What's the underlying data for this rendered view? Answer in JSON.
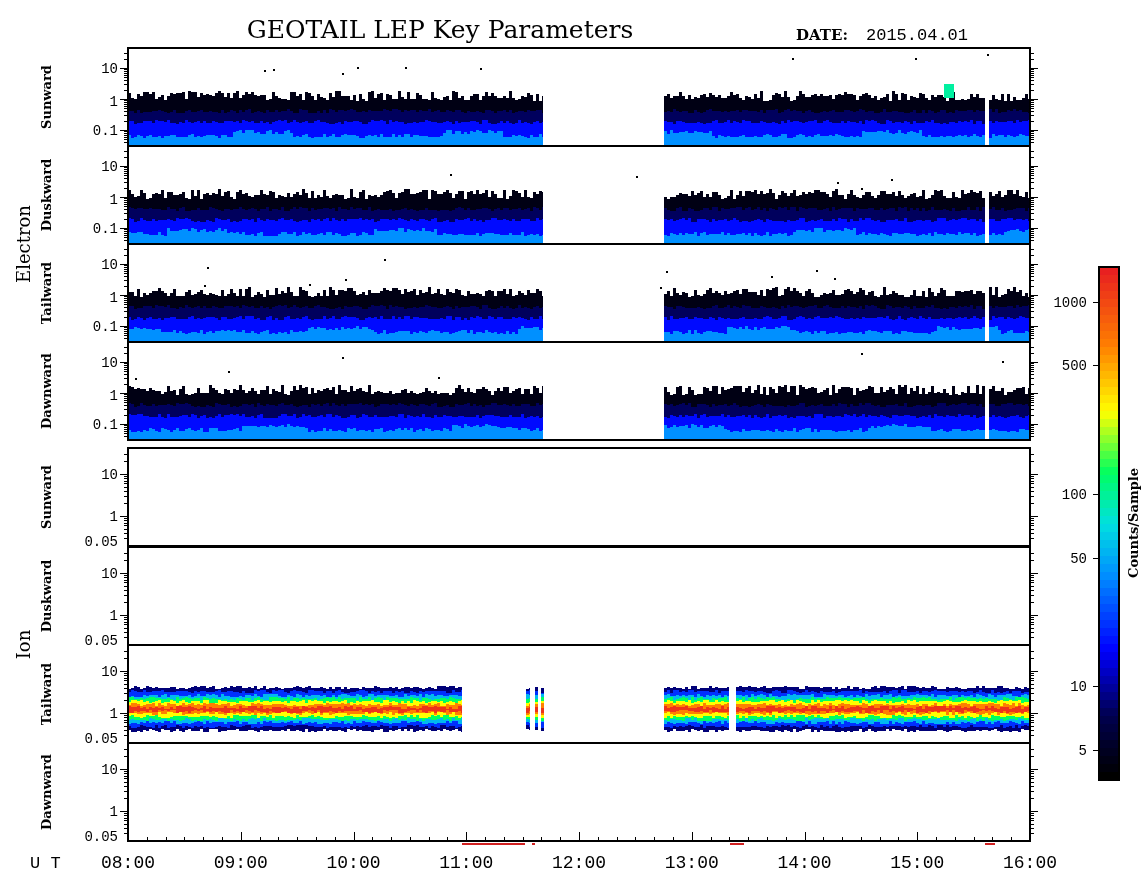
{
  "title": "GEOTAIL LEP Key Parameters",
  "date": {
    "label": "DATE:",
    "value": "2015.04.01"
  },
  "groups": [
    {
      "name": "Electron",
      "panels": [
        {
          "name": "Sunward",
          "kind": "electron",
          "yticks": [
            "10",
            "1",
            "0.1"
          ]
        },
        {
          "name": "Duskward",
          "kind": "electron",
          "yticks": [
            "10",
            "1",
            "0.1"
          ]
        },
        {
          "name": "Tailward",
          "kind": "electron",
          "yticks": [
            "10",
            "1",
            "0.1"
          ]
        },
        {
          "name": "Dawnward",
          "kind": "electron",
          "yticks": [
            "10",
            "1",
            "0.1"
          ]
        }
      ]
    },
    {
      "name": "Ion",
      "panels": [
        {
          "name": "Sunward",
          "kind": "empty",
          "yticks": [
            "10",
            "1",
            "0.05"
          ]
        },
        {
          "name": "Duskward",
          "kind": "empty",
          "yticks": [
            "10",
            "1",
            "0.05"
          ]
        },
        {
          "name": "Tailward",
          "kind": "ion",
          "yticks": [
            "10",
            "1",
            "0.05"
          ]
        },
        {
          "name": "Dawnward",
          "kind": "empty",
          "yticks": [
            "10",
            "1",
            "0.05"
          ]
        }
      ]
    }
  ],
  "x_axis": {
    "label": "U T",
    "ticks": [
      "08:00",
      "09:00",
      "10:00",
      "11:00",
      "12:00",
      "13:00",
      "14:00",
      "15:00",
      "16:00"
    ]
  },
  "colorbar": {
    "label": "Counts/Sample",
    "ticks": [
      "1000",
      "500",
      "100",
      "50",
      "10",
      "5"
    ]
  }
}
